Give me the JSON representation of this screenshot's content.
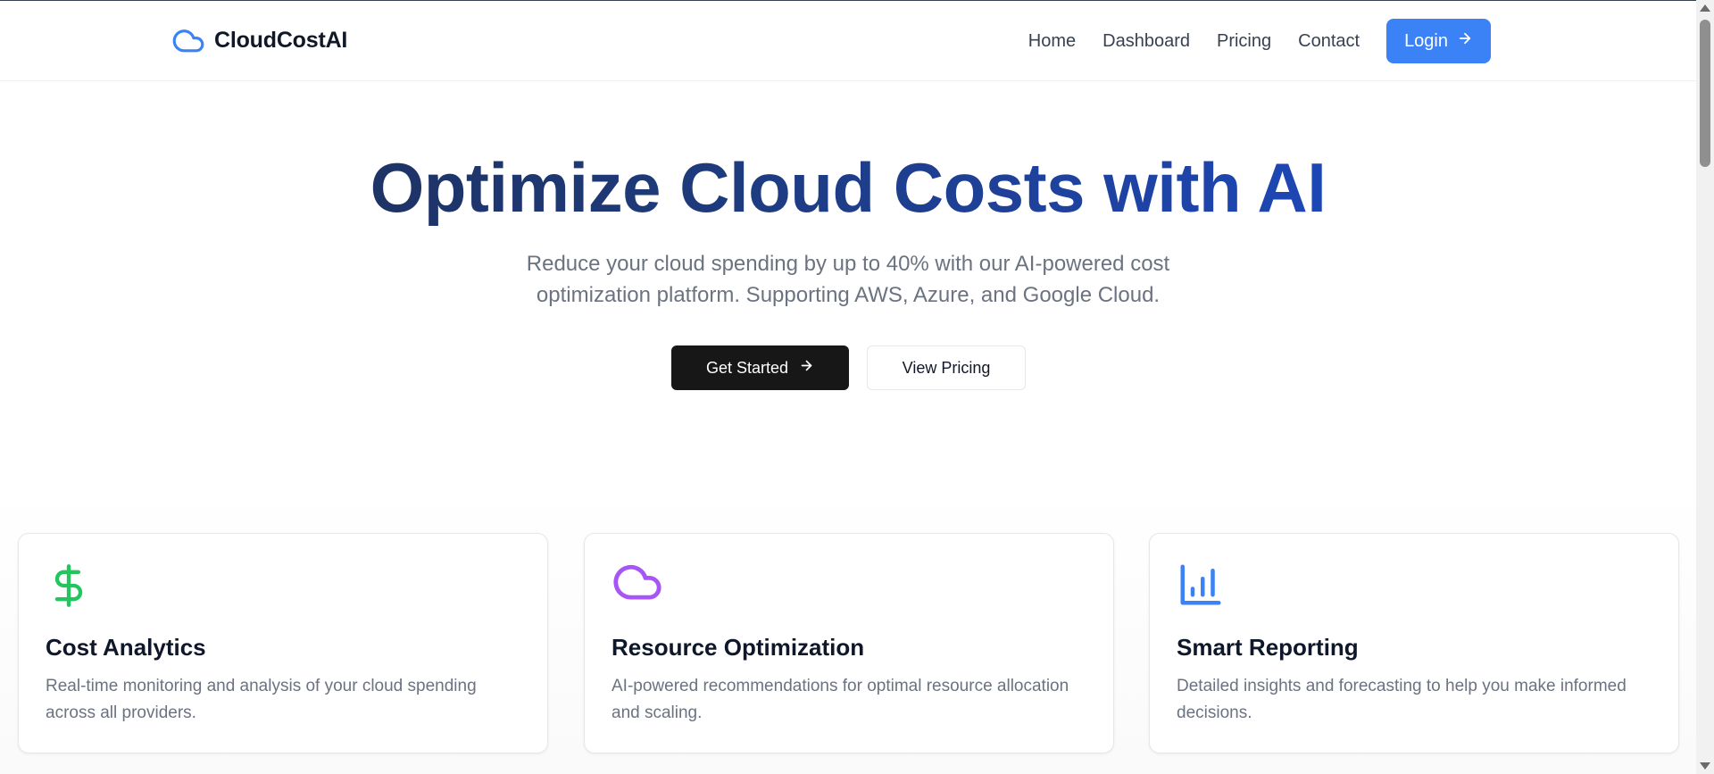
{
  "header": {
    "brand": "CloudCostAI",
    "brand_icon": "cloud-icon",
    "nav": [
      "Home",
      "Dashboard",
      "Pricing",
      "Contact"
    ],
    "login_label": "Login",
    "login_icon": "arrow-right-icon",
    "accent_color": "#3b82f6"
  },
  "hero": {
    "title": "Optimize Cloud Costs with AI",
    "subtitle": "Reduce your cloud spending by up to 40% with our AI-powered cost optimization platform. Supporting AWS, Azure, and Google Cloud.",
    "primary_button": "Get Started",
    "secondary_button": "View Pricing"
  },
  "features": [
    {
      "icon": "dollar-icon",
      "icon_color": "#22c55e",
      "title": "Cost Analytics",
      "description": "Real-time monitoring and analysis of your cloud spending across all providers."
    },
    {
      "icon": "cloud-icon",
      "icon_color": "#a855f7",
      "title": "Resource Optimization",
      "description": "AI-powered recommendations for optimal resource allocation and scaling."
    },
    {
      "icon": "bar-chart-icon",
      "icon_color": "#3b82f6",
      "title": "Smart Reporting",
      "description": "Detailed insights and forecasting to help you make informed decisions."
    }
  ]
}
